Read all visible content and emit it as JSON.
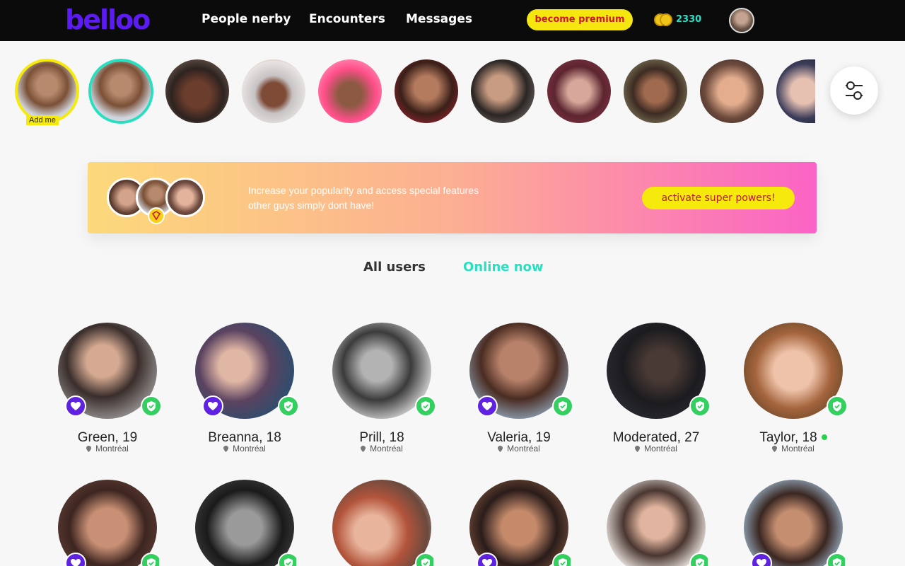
{
  "header": {
    "logo": "belloo",
    "nav": [
      "People nerby",
      "Encounters",
      "Messages"
    ],
    "premium_label": "become premium",
    "coins": "2330",
    "colors": {
      "bar": "#0b0b0b",
      "logo": "#5b1bf2",
      "premium_bg": "#f5e60f",
      "coins_text": "#24e0c8"
    }
  },
  "stories": {
    "add_me_label": "Add me",
    "count": 11
  },
  "promo": {
    "line1": "Increase your popularity and access special features",
    "line2": "other guys simply dont have!",
    "button": "activate super powers!"
  },
  "tabs": {
    "all": "All users",
    "online": "Online now",
    "colors": {
      "all": "#333333",
      "online": "#28e0bf"
    }
  },
  "users": [
    {
      "name": "Green, 19",
      "city": "Montréal",
      "liked": true,
      "online": false
    },
    {
      "name": "Breanna, 18",
      "city": "Montréal",
      "liked": true,
      "online": false
    },
    {
      "name": "Prill, 18",
      "city": "Montréal",
      "liked": false,
      "online": false
    },
    {
      "name": "Valeria, 19",
      "city": "Montréal",
      "liked": true,
      "online": false
    },
    {
      "name": "Moderated, 27",
      "city": "Montréal",
      "liked": false,
      "online": false
    },
    {
      "name": "Taylor, 18",
      "city": "Montréal",
      "liked": false,
      "online": true
    }
  ],
  "users_row2": [
    {
      "liked": true
    },
    {
      "liked": false
    },
    {
      "liked": false
    },
    {
      "liked": true
    },
    {
      "liked": false
    },
    {
      "liked": true
    }
  ]
}
